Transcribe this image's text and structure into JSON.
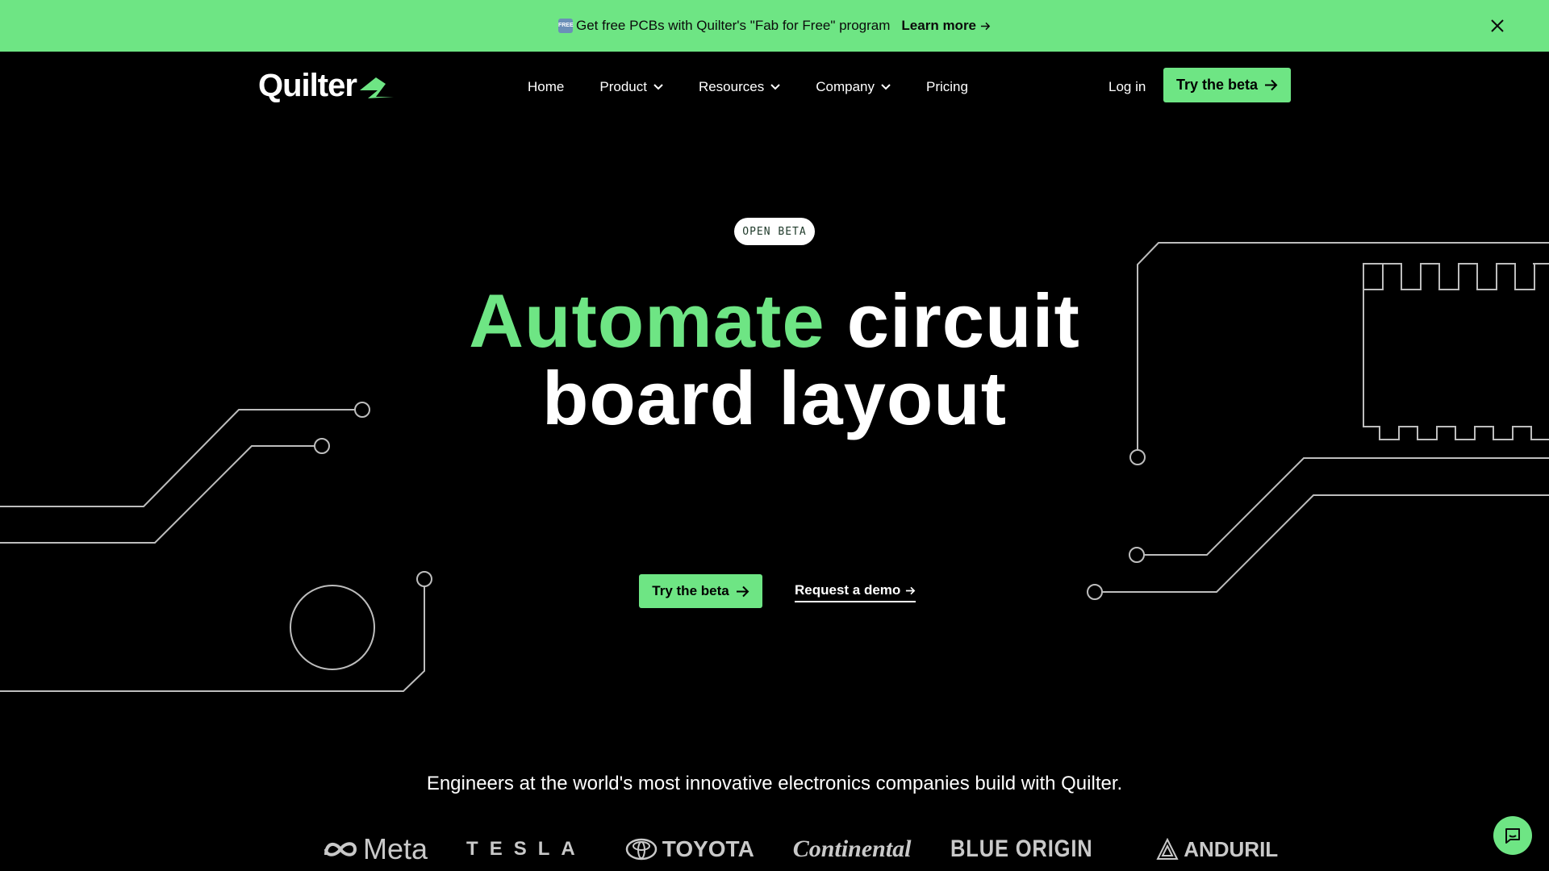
{
  "banner": {
    "badge": "FREE",
    "text": "Get free PCBs with Quilter's \"Fab for Free\" program",
    "learn_more": "Learn more"
  },
  "nav": {
    "logo": "Quilter",
    "items": [
      {
        "label": "Home"
      },
      {
        "label": "Product"
      },
      {
        "label": "Resources"
      },
      {
        "label": "Company"
      },
      {
        "label": "Pricing"
      }
    ],
    "login": "Log in",
    "cta": "Try the beta"
  },
  "hero": {
    "badge": "OPEN BETA",
    "title_accent": "Automate",
    "title_rest_1": "circuit",
    "title_line2": "board layout",
    "cta": "Try the beta",
    "demo": "Request a demo"
  },
  "social_proof": {
    "tagline": "Engineers at the world's most innovative electronics companies build with Quilter.",
    "brands": [
      "Meta",
      "TESLA",
      "TOYOTA",
      "Continental",
      "BLUE ORIGIN",
      "ANDURIL"
    ]
  },
  "colors": {
    "accent": "#6ee584",
    "background": "#000000",
    "circuit_lines": "#bdbdbd"
  },
  "icons": [
    "free-icon",
    "arrow-right-icon",
    "close-icon",
    "chevron-down-icon",
    "chat-icon"
  ]
}
